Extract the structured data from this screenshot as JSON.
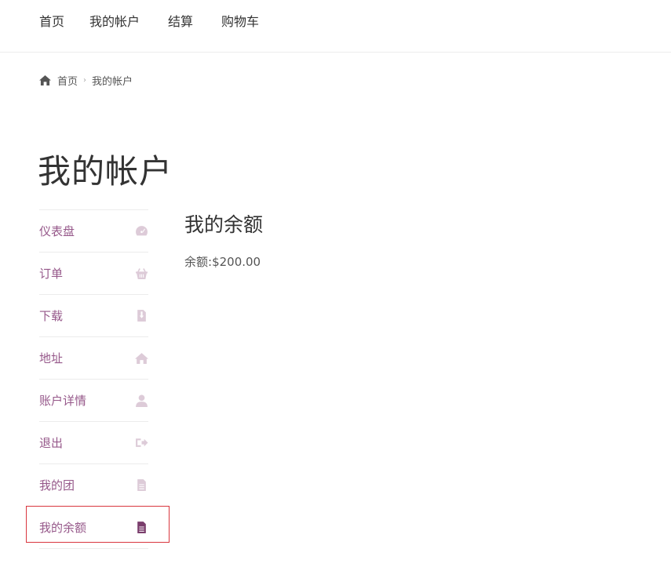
{
  "topnav": {
    "items": [
      {
        "label": "首页"
      },
      {
        "label": "我的帐户"
      },
      {
        "label": "结算"
      },
      {
        "label": "购物车"
      }
    ]
  },
  "breadcrumb": {
    "icon": "home-icon",
    "home_label": "首页",
    "separator": "›",
    "current": "我的帐户"
  },
  "page": {
    "title": "我的帐户"
  },
  "account_nav": {
    "items": [
      {
        "label": "仪表盘",
        "icon": "dashboard-icon"
      },
      {
        "label": "订单",
        "icon": "basket-icon"
      },
      {
        "label": "下载",
        "icon": "file-download-icon"
      },
      {
        "label": "地址",
        "icon": "home-icon"
      },
      {
        "label": "账户详情",
        "icon": "user-icon"
      },
      {
        "label": "退出",
        "icon": "sign-out-icon"
      },
      {
        "label": "我的团",
        "icon": "document-icon"
      },
      {
        "label": "我的余额",
        "icon": "document-icon",
        "active": true
      }
    ]
  },
  "content": {
    "heading": "我的余额",
    "balance_label": "余额:",
    "balance_value": "$200.00"
  },
  "colors": {
    "link": "#96588a",
    "icon_inactive": "#ddcbd8",
    "icon_active": "#7a3d6c",
    "highlight_border": "#d9363e"
  }
}
